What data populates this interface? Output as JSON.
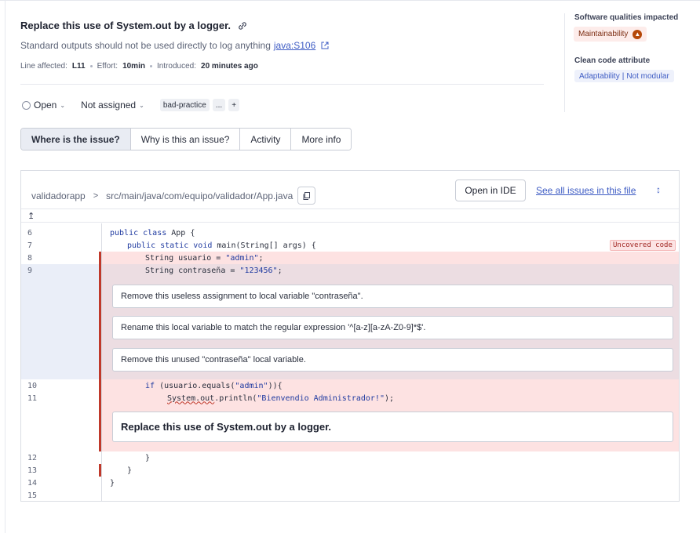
{
  "issue": {
    "title": "Replace this use of System.out by a logger.",
    "description": "Standard outputs should not be used directly to log anything",
    "rule_link": "java:S106",
    "line_label": "Line affected:",
    "line_value": "L11",
    "effort_label": "Effort:",
    "effort_value": "10min",
    "introduced_label": "Introduced:",
    "introduced_value": "20 minutes ago"
  },
  "sidebar": {
    "qualities_heading": "Software qualities impacted",
    "quality_tag": "Maintainability",
    "clean_heading": "Clean code attribute",
    "clean_tag_a": "Adaptability",
    "clean_tag_sep": "|",
    "clean_tag_b": "Not modular"
  },
  "status": {
    "open": "Open",
    "assignee": "Not assigned",
    "tag": "bad-practice",
    "more": "...",
    "add": "+"
  },
  "tabs": [
    {
      "label": "Where is the issue?"
    },
    {
      "label": "Why is this an issue?"
    },
    {
      "label": "Activity"
    },
    {
      "label": "More info"
    }
  ],
  "file": {
    "project": "validadorapp",
    "separator": ">",
    "path": "src/main/java/com/equipo/validador/App.java",
    "open_ide": "Open in IDE",
    "see_all": "See all issues in this file",
    "uncovered": "Uncovered code"
  },
  "code": {
    "l6": "6",
    "l7": "7",
    "l8": "8",
    "l9": "9",
    "l10": "10",
    "l11": "11",
    "l12": "12",
    "l13": "13",
    "l14": "14",
    "l15": "15",
    "c6_kw": "public class",
    "c6_rest": " App {",
    "c7_kw": "public static void",
    "c7_rest": " main(String[] args) {",
    "c8_a": "String usuario = ",
    "c8_str": "\"admin\"",
    "c8_b": ";",
    "c9_a": "String contraseña = ",
    "c9_str": "\"123456\"",
    "c9_b": ";",
    "c10_kw": "if",
    "c10_a": " (usuario.equals(",
    "c10_str": "\"admin\"",
    "c10_b": ")){",
    "c11_a": "System.out",
    "c11_b": ".println(",
    "c11_str": "\"Bienvendio Administrador!\"",
    "c11_c": ");",
    "c12": "}",
    "c13": "}",
    "c14": "}"
  },
  "messages": {
    "m1": "Remove this useless assignment to local variable \"contraseña\".",
    "m2": "Rename this local variable to match the regular expression '^[a-z][a-zA-Z0-9]*$'.",
    "m3": "Remove this unused \"contraseña\" local variable.",
    "m4": "Replace this use of System.out by a logger."
  }
}
